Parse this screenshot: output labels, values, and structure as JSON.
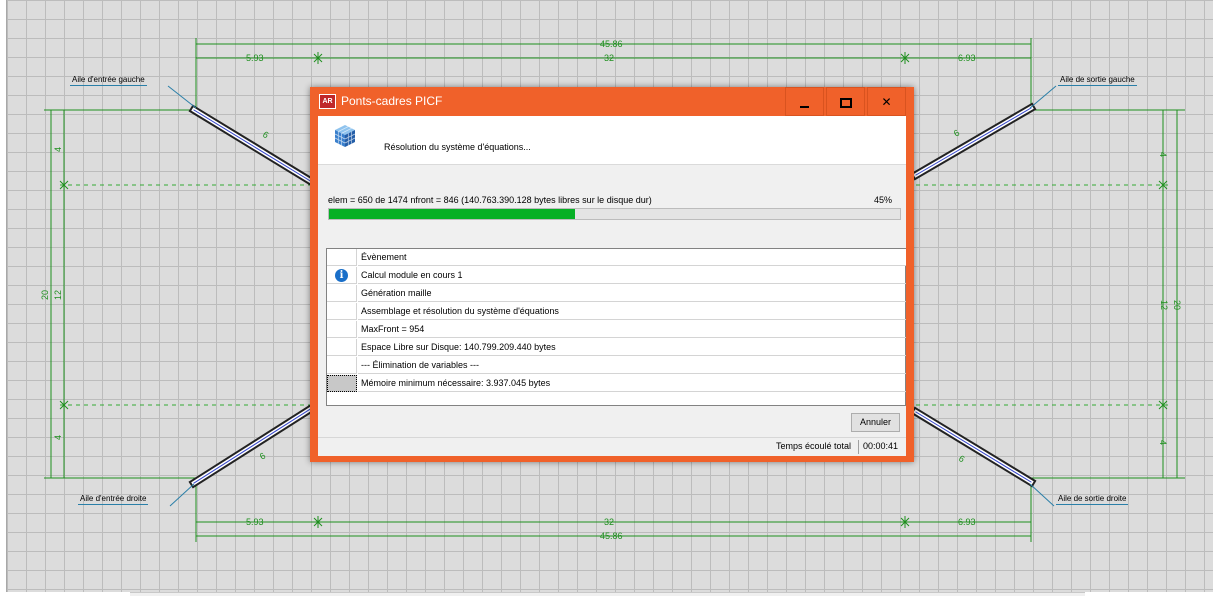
{
  "drawing": {
    "dim_total": "45.86",
    "dim_center": "32",
    "dim_side_left": "5.93",
    "dim_side_right": "6.93",
    "dim_height_outer": "20",
    "dim_height_inner": "12",
    "dim_small": "4",
    "dim_wing": "6",
    "labels": {
      "entry_left": "Aile d'entrée gauche",
      "exit_left": "Aile de sortie gauche",
      "entry_right": "Aile d'entrée droite",
      "exit_right": "Aile de sortie droite"
    }
  },
  "dialog": {
    "title": "Ponts-cadres PICF",
    "app_icon": "AR",
    "header_text": "Résolution du système d'équations...",
    "progress_text": "elem = 650 de 1474 nfront = 846 (140.763.390.128 bytes libres sur le disque dur)",
    "progress_percent_label": "45%",
    "progress_value": 0.43,
    "events_header": "Évènement",
    "events": [
      "Calcul module en cours 1",
      "Génération maille",
      "Assemblage et résolution du système d'équations",
      "MaxFront = 954",
      "Espace Libre sur Disque: 140.799.209.440 bytes",
      "--- Élimination de variables ---",
      "Mémoire minimum nécessaire: 3.937.045 bytes"
    ],
    "cancel_label": "Annuler",
    "status_label": "Temps écoulé total",
    "status_time": "00:00:41"
  },
  "colors": {
    "titlebar": "#f0612a",
    "progress_fill": "#06b025",
    "dimension_line": "#1e8f1e"
  }
}
